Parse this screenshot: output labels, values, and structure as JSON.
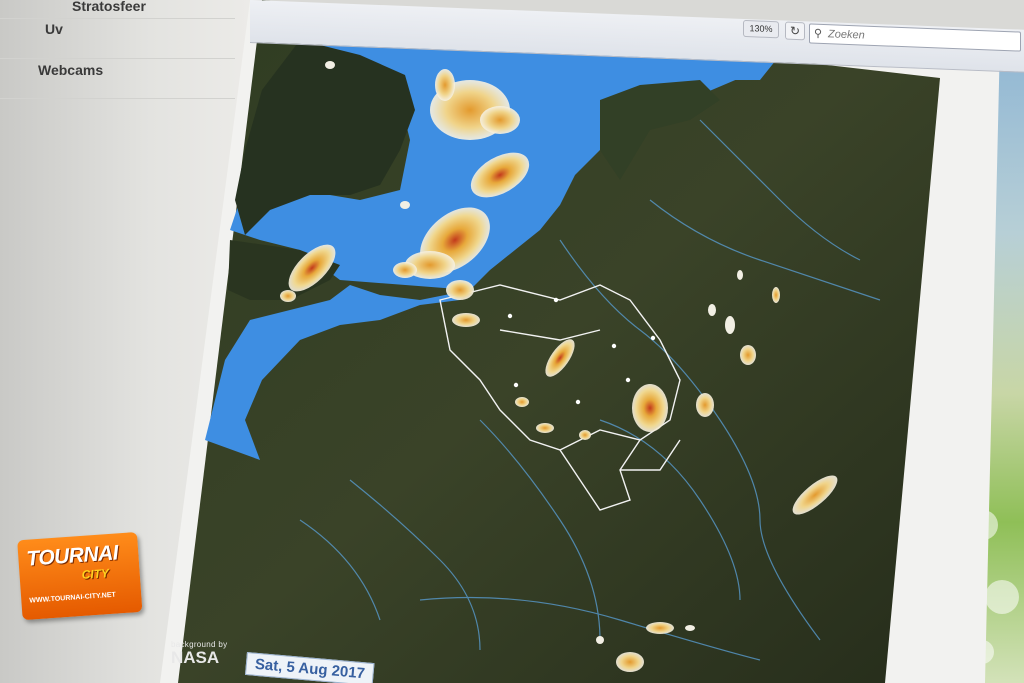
{
  "sidebar": {
    "items": [
      {
        "label": "Stratosfeer"
      },
      {
        "label": "Uv"
      },
      {
        "label": "Webcams"
      }
    ]
  },
  "toolbar": {
    "zoom": "130%",
    "refresh_icon": "refresh-icon",
    "search_placeholder": "Zoeken",
    "search_icon": "magnifier-icon"
  },
  "map": {
    "credit_line": "background by",
    "credit_brand": "NASA",
    "date_label": "Sat, 5 Aug 2017"
  },
  "logo": {
    "name_top": "TOURNAI",
    "name_bottom": "CITY",
    "url": "WWW.TOURNAI-CITY.NET"
  },
  "colors": {
    "sea": "#3e8ee2",
    "land": "#2e3a22",
    "rain_light": "#f0e6c4",
    "rain_mid": "#e7a83a",
    "rain_heavy": "#c23a1c",
    "logo_orange": "#f07a10",
    "date_text": "#3760a0"
  }
}
